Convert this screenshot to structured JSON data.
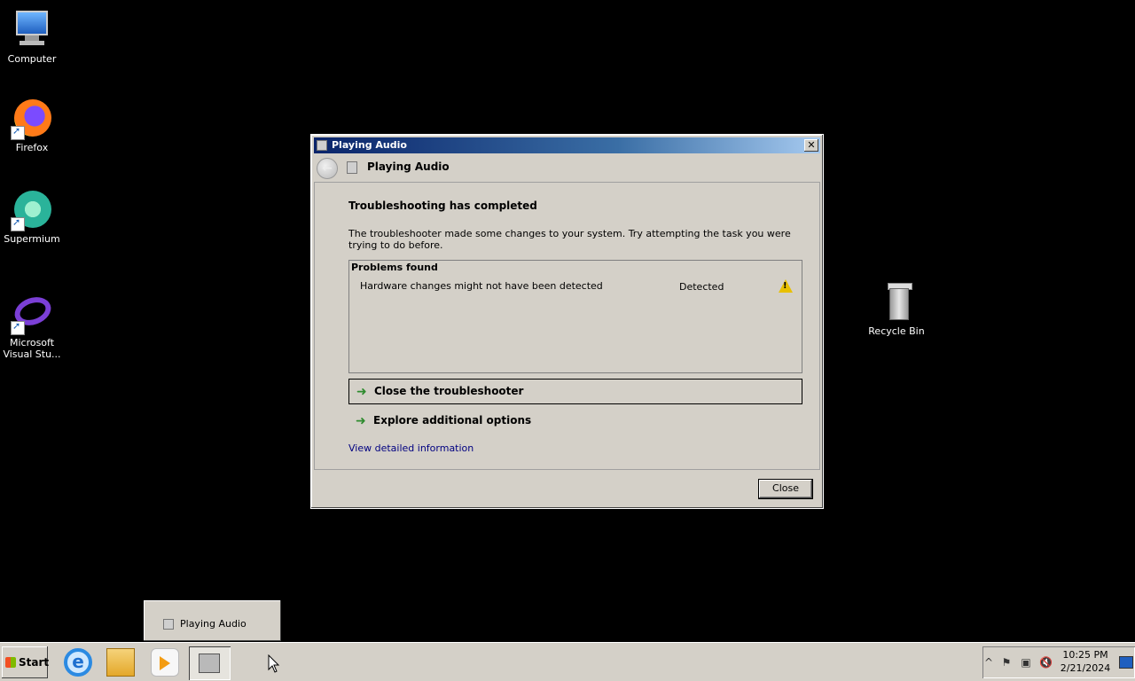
{
  "desktop": {
    "icons": [
      {
        "label": "Computer"
      },
      {
        "label": "Firefox"
      },
      {
        "label": "Supermium"
      },
      {
        "label": "Microsoft Visual Stu..."
      },
      {
        "label": "Recycle Bin"
      }
    ]
  },
  "dialog": {
    "title": "Playing Audio",
    "close_x": "✕",
    "nav_title": "Playing Audio",
    "heading": "Troubleshooting has completed",
    "description": "The troubleshooter made some changes to your system. Try attempting the task you were trying to do before.",
    "problems": {
      "header": "Problems found",
      "rows": [
        {
          "name": "Hardware changes might not have been detected",
          "status": "Detected",
          "icon": "warning-icon"
        }
      ]
    },
    "options": [
      {
        "label": "Close the troubleshooter"
      },
      {
        "label": "Explore additional options"
      }
    ],
    "link": "View detailed information",
    "close_button": "Close"
  },
  "taskbar": {
    "start_label": "Start",
    "thumbnail_label": "Playing Audio",
    "clock_time": "10:25 PM",
    "clock_date": "2/21/2024",
    "tray_expand": "^"
  }
}
